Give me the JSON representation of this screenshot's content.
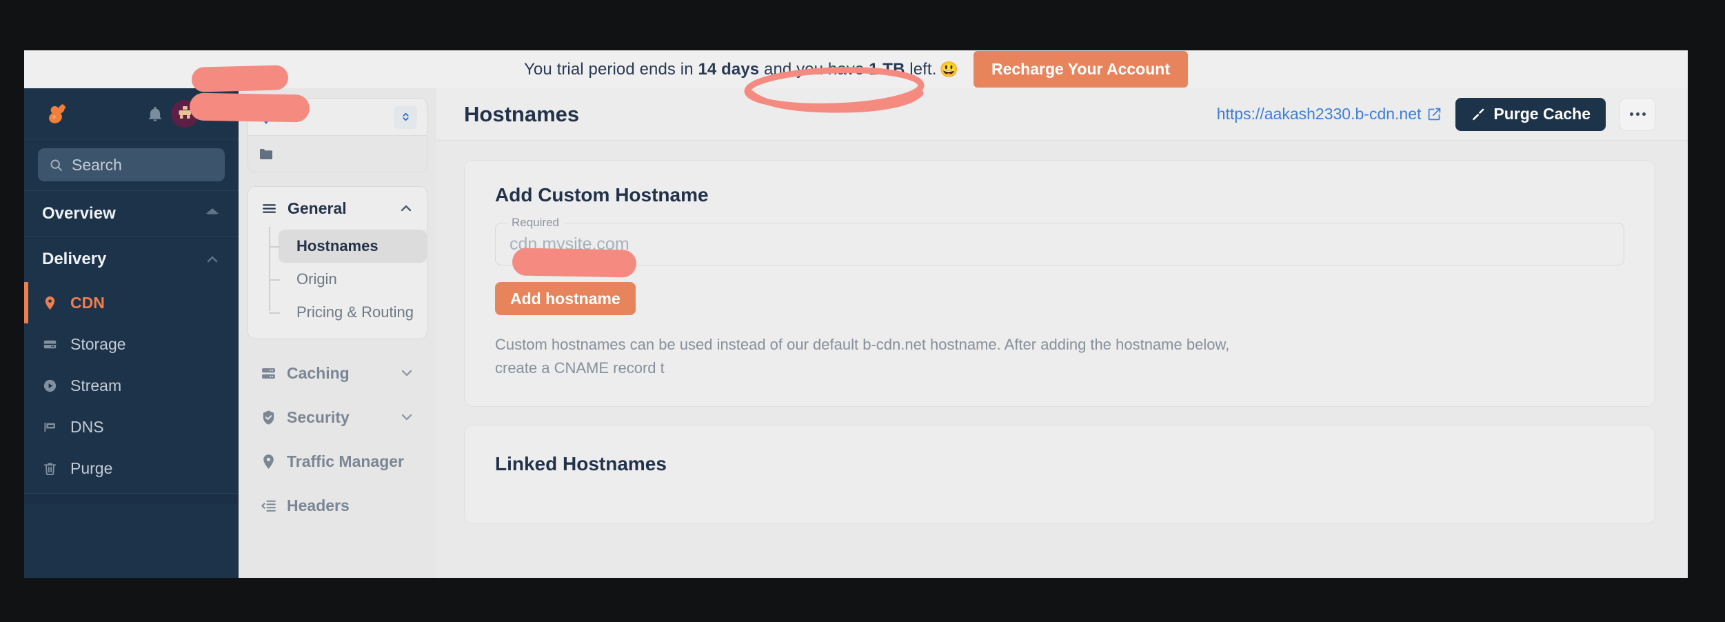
{
  "banner": {
    "text_before": "You trial period ends in ",
    "days": "14 days",
    "text_middle": " and you have ",
    "quota": "1 TB",
    "text_after": " left.",
    "emoji": "😃",
    "recharge_label": "Recharge Your Account",
    "accent_color": "#e8845c"
  },
  "sidebar": {
    "logo_name": "bunny-logo",
    "search_placeholder": "Search",
    "overview_label": "Overview",
    "delivery_label": "Delivery",
    "items": [
      {
        "label": "CDN",
        "icon": "pin-icon",
        "active": true
      },
      {
        "label": "Storage",
        "icon": "storage-icon",
        "active": false
      },
      {
        "label": "Stream",
        "icon": "play-circle-icon",
        "active": false
      },
      {
        "label": "DNS",
        "icon": "flag-icon",
        "active": false
      },
      {
        "label": "Purge",
        "icon": "trash-icon",
        "active": false
      }
    ],
    "active_color": "#ef7e4e",
    "background_color": "#1d3349"
  },
  "sub_panel": {
    "context_rows": [
      {
        "icon": "pin-icon",
        "redacted": true
      },
      {
        "icon": "folder-icon",
        "redacted": true
      }
    ],
    "general_group": {
      "label": "General",
      "icon": "hamburger-icon",
      "expanded": true,
      "items": [
        {
          "label": "Hostnames",
          "active": true
        },
        {
          "label": "Origin",
          "active": false
        },
        {
          "label": "Pricing & Routing",
          "active": false
        }
      ]
    },
    "groups": [
      {
        "label": "Caching",
        "icon": "server-icon",
        "expanded": false,
        "has_caret": true
      },
      {
        "label": "Security",
        "icon": "shield-check-icon",
        "expanded": false,
        "has_caret": true
      },
      {
        "label": "Traffic Manager",
        "icon": "pin-icon",
        "expanded": false,
        "has_caret": false
      },
      {
        "label": "Headers",
        "icon": "headers-icon",
        "expanded": false,
        "has_caret": false
      }
    ]
  },
  "main": {
    "page_title": "Hostnames",
    "cdn_url": "https://aakash2330.b-cdn.net",
    "purge_label": "Purge Cache",
    "more_label": "…",
    "add_panel": {
      "title": "Add Custom Hostname",
      "field_legend": "Required",
      "field_placeholder": "cdn.mysite.com",
      "field_value": "",
      "button_label": "Add hostname",
      "description_line1": "Custom hostnames can be used instead of our default b-cdn.net hostname. After adding the hostname below,",
      "description_line2": "create a CNAME record t"
    },
    "linked_panel": {
      "title": "Linked Hostnames"
    }
  }
}
